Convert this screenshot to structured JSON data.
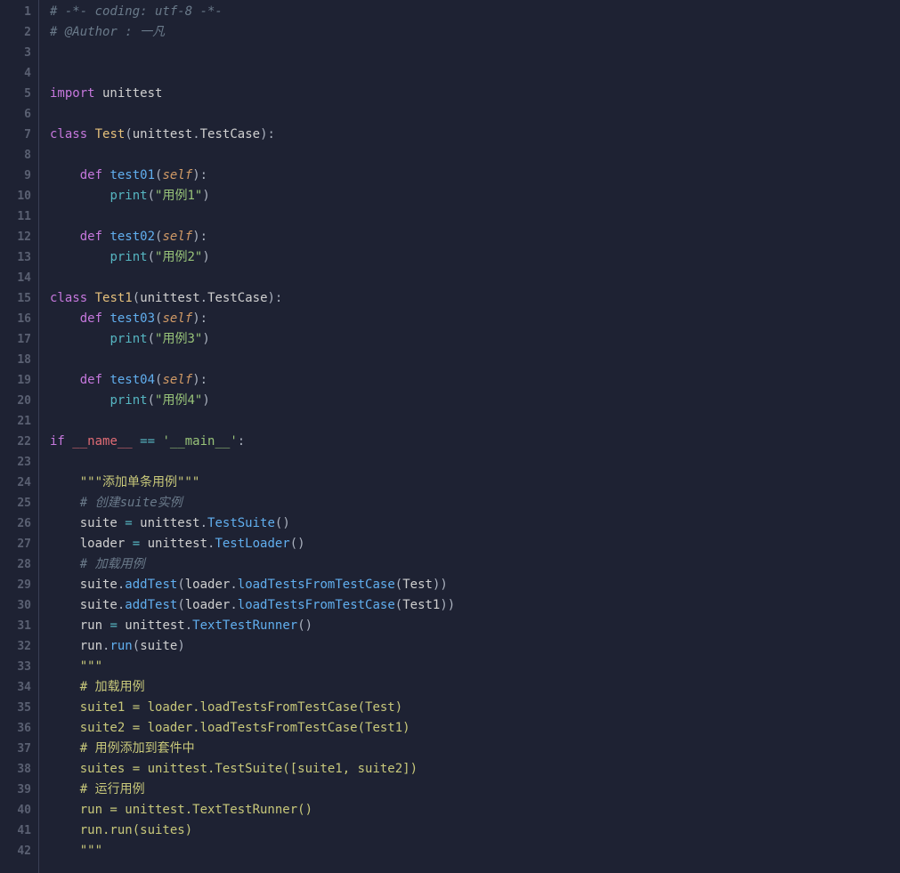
{
  "lines": [
    {
      "n": "1",
      "tokens": [
        {
          "c": "c-comment",
          "t": "# -*- coding: utf-8 -*-"
        }
      ]
    },
    {
      "n": "2",
      "tokens": [
        {
          "c": "c-comment",
          "t": "# @Author : 一凡"
        }
      ]
    },
    {
      "n": "3",
      "tokens": []
    },
    {
      "n": "4",
      "tokens": []
    },
    {
      "n": "5",
      "tokens": [
        {
          "c": "c-kw",
          "t": "import"
        },
        {
          "c": "c-white",
          "t": " unittest"
        }
      ]
    },
    {
      "n": "6",
      "tokens": []
    },
    {
      "n": "7",
      "tokens": [
        {
          "c": "c-kw",
          "t": "class"
        },
        {
          "c": "c-white",
          "t": " "
        },
        {
          "c": "c-cls",
          "t": "Test"
        },
        {
          "c": "c-punc",
          "t": "("
        },
        {
          "c": "c-white",
          "t": "unittest"
        },
        {
          "c": "c-punc",
          "t": "."
        },
        {
          "c": "c-white",
          "t": "TestCase"
        },
        {
          "c": "c-punc",
          "t": "):"
        }
      ]
    },
    {
      "n": "8",
      "tokens": []
    },
    {
      "n": "9",
      "tokens": [
        {
          "c": "c-white",
          "t": "    "
        },
        {
          "c": "c-kw",
          "t": "def"
        },
        {
          "c": "c-white",
          "t": " "
        },
        {
          "c": "c-def",
          "t": "test01"
        },
        {
          "c": "c-punc",
          "t": "("
        },
        {
          "c": "c-self",
          "t": "self"
        },
        {
          "c": "c-punc",
          "t": "):"
        }
      ]
    },
    {
      "n": "10",
      "tokens": [
        {
          "c": "c-white",
          "t": "        "
        },
        {
          "c": "c-call",
          "t": "print"
        },
        {
          "c": "c-punc",
          "t": "("
        },
        {
          "c": "c-str",
          "t": "\"用例1\""
        },
        {
          "c": "c-punc",
          "t": ")"
        }
      ]
    },
    {
      "n": "11",
      "tokens": []
    },
    {
      "n": "12",
      "tokens": [
        {
          "c": "c-white",
          "t": "    "
        },
        {
          "c": "c-kw",
          "t": "def"
        },
        {
          "c": "c-white",
          "t": " "
        },
        {
          "c": "c-def",
          "t": "test02"
        },
        {
          "c": "c-punc",
          "t": "("
        },
        {
          "c": "c-self",
          "t": "self"
        },
        {
          "c": "c-punc",
          "t": "):"
        }
      ]
    },
    {
      "n": "13",
      "tokens": [
        {
          "c": "c-white",
          "t": "        "
        },
        {
          "c": "c-call",
          "t": "print"
        },
        {
          "c": "c-punc",
          "t": "("
        },
        {
          "c": "c-str",
          "t": "\"用例2\""
        },
        {
          "c": "c-punc",
          "t": ")"
        }
      ]
    },
    {
      "n": "14",
      "tokens": []
    },
    {
      "n": "15",
      "tokens": [
        {
          "c": "c-kw",
          "t": "class"
        },
        {
          "c": "c-white",
          "t": " "
        },
        {
          "c": "c-cls",
          "t": "Test1"
        },
        {
          "c": "c-punc",
          "t": "("
        },
        {
          "c": "c-white",
          "t": "unittest"
        },
        {
          "c": "c-punc",
          "t": "."
        },
        {
          "c": "c-white",
          "t": "TestCase"
        },
        {
          "c": "c-punc",
          "t": "):"
        }
      ]
    },
    {
      "n": "16",
      "tokens": [
        {
          "c": "c-white",
          "t": "    "
        },
        {
          "c": "c-kw",
          "t": "def"
        },
        {
          "c": "c-white",
          "t": " "
        },
        {
          "c": "c-def",
          "t": "test03"
        },
        {
          "c": "c-punc",
          "t": "("
        },
        {
          "c": "c-self",
          "t": "self"
        },
        {
          "c": "c-punc",
          "t": "):"
        }
      ]
    },
    {
      "n": "17",
      "tokens": [
        {
          "c": "c-white",
          "t": "        "
        },
        {
          "c": "c-call",
          "t": "print"
        },
        {
          "c": "c-punc",
          "t": "("
        },
        {
          "c": "c-str",
          "t": "\"用例3\""
        },
        {
          "c": "c-punc",
          "t": ")"
        }
      ]
    },
    {
      "n": "18",
      "tokens": []
    },
    {
      "n": "19",
      "tokens": [
        {
          "c": "c-white",
          "t": "    "
        },
        {
          "c": "c-kw",
          "t": "def"
        },
        {
          "c": "c-white",
          "t": " "
        },
        {
          "c": "c-def",
          "t": "test04"
        },
        {
          "c": "c-punc",
          "t": "("
        },
        {
          "c": "c-self",
          "t": "self"
        },
        {
          "c": "c-punc",
          "t": "):"
        }
      ]
    },
    {
      "n": "20",
      "tokens": [
        {
          "c": "c-white",
          "t": "        "
        },
        {
          "c": "c-call",
          "t": "print"
        },
        {
          "c": "c-punc",
          "t": "("
        },
        {
          "c": "c-str",
          "t": "\"用例4\""
        },
        {
          "c": "c-punc",
          "t": ")"
        }
      ]
    },
    {
      "n": "21",
      "tokens": []
    },
    {
      "n": "22",
      "tokens": [
        {
          "c": "c-kw",
          "t": "if"
        },
        {
          "c": "c-white",
          "t": " "
        },
        {
          "c": "c-dunder",
          "t": "__name__"
        },
        {
          "c": "c-white",
          "t": " "
        },
        {
          "c": "c-op",
          "t": "=="
        },
        {
          "c": "c-white",
          "t": " "
        },
        {
          "c": "c-str",
          "t": "'__main__'"
        },
        {
          "c": "c-punc",
          "t": ":"
        }
      ]
    },
    {
      "n": "23",
      "tokens": []
    },
    {
      "n": "24",
      "tokens": [
        {
          "c": "c-white",
          "t": "    "
        },
        {
          "c": "c-docstr",
          "t": "\"\"\"添加单条用例\"\"\""
        }
      ]
    },
    {
      "n": "25",
      "tokens": [
        {
          "c": "c-white",
          "t": "    "
        },
        {
          "c": "c-comment",
          "t": "# 创建suite实例"
        }
      ]
    },
    {
      "n": "26",
      "tokens": [
        {
          "c": "c-white",
          "t": "    suite "
        },
        {
          "c": "c-op",
          "t": "="
        },
        {
          "c": "c-white",
          "t": " unittest"
        },
        {
          "c": "c-punc",
          "t": "."
        },
        {
          "c": "c-func",
          "t": "TestSuite"
        },
        {
          "c": "c-punc",
          "t": "()"
        }
      ]
    },
    {
      "n": "27",
      "tokens": [
        {
          "c": "c-white",
          "t": "    loader "
        },
        {
          "c": "c-op",
          "t": "="
        },
        {
          "c": "c-white",
          "t": " unittest"
        },
        {
          "c": "c-punc",
          "t": "."
        },
        {
          "c": "c-func",
          "t": "TestLoader"
        },
        {
          "c": "c-punc",
          "t": "()"
        }
      ]
    },
    {
      "n": "28",
      "tokens": [
        {
          "c": "c-white",
          "t": "    "
        },
        {
          "c": "c-comment",
          "t": "# 加载用例"
        }
      ]
    },
    {
      "n": "29",
      "tokens": [
        {
          "c": "c-white",
          "t": "    suite"
        },
        {
          "c": "c-punc",
          "t": "."
        },
        {
          "c": "c-func",
          "t": "addTest"
        },
        {
          "c": "c-punc",
          "t": "("
        },
        {
          "c": "c-white",
          "t": "loader"
        },
        {
          "c": "c-punc",
          "t": "."
        },
        {
          "c": "c-func",
          "t": "loadTestsFromTestCase"
        },
        {
          "c": "c-punc",
          "t": "("
        },
        {
          "c": "c-white",
          "t": "Test"
        },
        {
          "c": "c-punc",
          "t": "))"
        }
      ]
    },
    {
      "n": "30",
      "tokens": [
        {
          "c": "c-white",
          "t": "    suite"
        },
        {
          "c": "c-punc",
          "t": "."
        },
        {
          "c": "c-func",
          "t": "addTest"
        },
        {
          "c": "c-punc",
          "t": "("
        },
        {
          "c": "c-white",
          "t": "loader"
        },
        {
          "c": "c-punc",
          "t": "."
        },
        {
          "c": "c-func",
          "t": "loadTestsFromTestCase"
        },
        {
          "c": "c-punc",
          "t": "("
        },
        {
          "c": "c-white",
          "t": "Test1"
        },
        {
          "c": "c-punc",
          "t": "))"
        }
      ]
    },
    {
      "n": "31",
      "tokens": [
        {
          "c": "c-white",
          "t": "    run "
        },
        {
          "c": "c-op",
          "t": "="
        },
        {
          "c": "c-white",
          "t": " unittest"
        },
        {
          "c": "c-punc",
          "t": "."
        },
        {
          "c": "c-func",
          "t": "TextTestRunner"
        },
        {
          "c": "c-punc",
          "t": "()"
        }
      ]
    },
    {
      "n": "32",
      "tokens": [
        {
          "c": "c-white",
          "t": "    run"
        },
        {
          "c": "c-punc",
          "t": "."
        },
        {
          "c": "c-func",
          "t": "run"
        },
        {
          "c": "c-punc",
          "t": "("
        },
        {
          "c": "c-white",
          "t": "suite"
        },
        {
          "c": "c-punc",
          "t": ")"
        }
      ]
    },
    {
      "n": "33",
      "tokens": [
        {
          "c": "c-white",
          "t": "    "
        },
        {
          "c": "c-docstr",
          "t": "\"\"\""
        }
      ]
    },
    {
      "n": "34",
      "tokens": [
        {
          "c": "c-white",
          "t": "    "
        },
        {
          "c": "c-docstr",
          "t": "# 加载用例"
        }
      ]
    },
    {
      "n": "35",
      "tokens": [
        {
          "c": "c-white",
          "t": "    "
        },
        {
          "c": "c-docstr",
          "t": "suite1 = loader.loadTestsFromTestCase(Test)"
        }
      ]
    },
    {
      "n": "36",
      "tokens": [
        {
          "c": "c-white",
          "t": "    "
        },
        {
          "c": "c-docstr",
          "t": "suite2 = loader.loadTestsFromTestCase(Test1)"
        }
      ]
    },
    {
      "n": "37",
      "tokens": [
        {
          "c": "c-white",
          "t": "    "
        },
        {
          "c": "c-docstr",
          "t": "# 用例添加到套件中"
        }
      ]
    },
    {
      "n": "38",
      "tokens": [
        {
          "c": "c-white",
          "t": "    "
        },
        {
          "c": "c-docstr",
          "t": "suites = unittest.TestSuite([suite1, suite2])"
        }
      ]
    },
    {
      "n": "39",
      "tokens": [
        {
          "c": "c-white",
          "t": "    "
        },
        {
          "c": "c-docstr",
          "t": "# 运行用例"
        }
      ]
    },
    {
      "n": "40",
      "tokens": [
        {
          "c": "c-white",
          "t": "    "
        },
        {
          "c": "c-docstr",
          "t": "run = unittest.TextTestRunner()"
        }
      ]
    },
    {
      "n": "41",
      "tokens": [
        {
          "c": "c-white",
          "t": "    "
        },
        {
          "c": "c-docstr",
          "t": "run.run(suites)"
        }
      ]
    },
    {
      "n": "42",
      "tokens": [
        {
          "c": "c-white",
          "t": "    "
        },
        {
          "c": "c-docstr",
          "t": "\"\"\""
        }
      ]
    }
  ]
}
